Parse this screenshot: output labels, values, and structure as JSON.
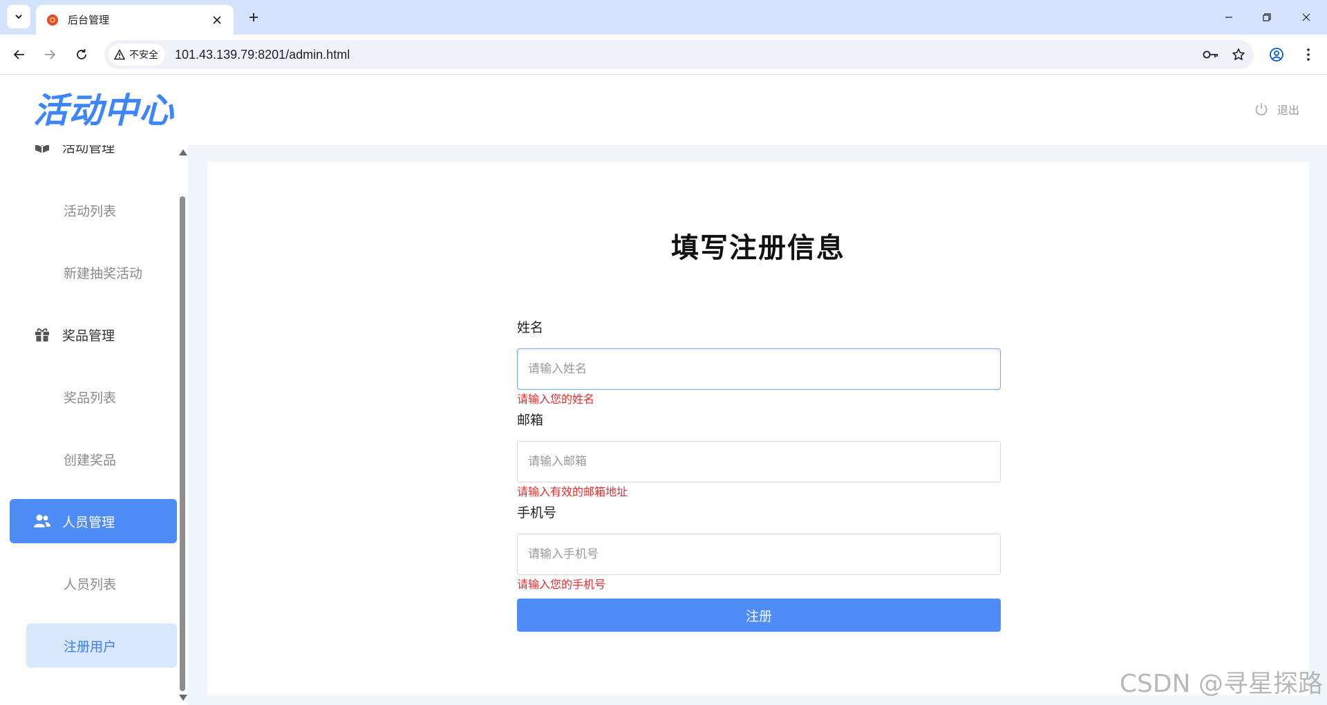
{
  "browser": {
    "tab_title": "后台管理",
    "security_label": "不安全",
    "url": "101.43.139.79:8201/admin.html",
    "icons": {
      "tab_list": "chevron-down-icon",
      "favicon": "favicon-icon",
      "tab_close": "close-icon",
      "new_tab": "plus-icon",
      "minimize": "minimize-icon",
      "restore": "restore-icon",
      "close_window": "close-icon",
      "back": "back-arrow-icon",
      "forward": "forward-arrow-icon",
      "reload": "reload-icon",
      "warning": "warning-icon",
      "password": "key-icon",
      "bookmark": "star-icon",
      "profile": "profile-icon",
      "menu": "more-vert-icon"
    }
  },
  "header": {
    "logo_text": "活动中心",
    "logout_label": "退出",
    "logout_icon": "power-icon"
  },
  "sidebar": {
    "groups": [
      {
        "label": "活动管理",
        "icon": "box-icon",
        "items": [
          {
            "label": "活动列表"
          },
          {
            "label": "新建抽奖活动"
          }
        ]
      },
      {
        "label": "奖品管理",
        "icon": "gift-icon",
        "items": [
          {
            "label": "奖品列表"
          },
          {
            "label": "创建奖品"
          }
        ]
      },
      {
        "label": "人员管理",
        "icon": "users-icon",
        "active": true,
        "items": [
          {
            "label": "人员列表"
          },
          {
            "label": "注册用户",
            "selected": true
          }
        ]
      }
    ]
  },
  "form": {
    "title": "填写注册信息",
    "fields": [
      {
        "label": "姓名",
        "value": "",
        "placeholder": "请输入姓名",
        "error": "请输入您的姓名"
      },
      {
        "label": "邮箱",
        "value": "",
        "placeholder": "请输入邮箱",
        "error": "请输入有效的邮箱地址"
      },
      {
        "label": "手机号",
        "value": "",
        "placeholder": "请输入手机号",
        "error": "请输入您的手机号"
      }
    ],
    "submit_label": "注册"
  },
  "watermark": "CSDN @寻星探路",
  "colors": {
    "accent": "#4e8df5",
    "logo": "#3d84ff",
    "error": "#e03131",
    "selected_bg": "#d9e7fd",
    "content_bg": "#f0f4fb"
  }
}
